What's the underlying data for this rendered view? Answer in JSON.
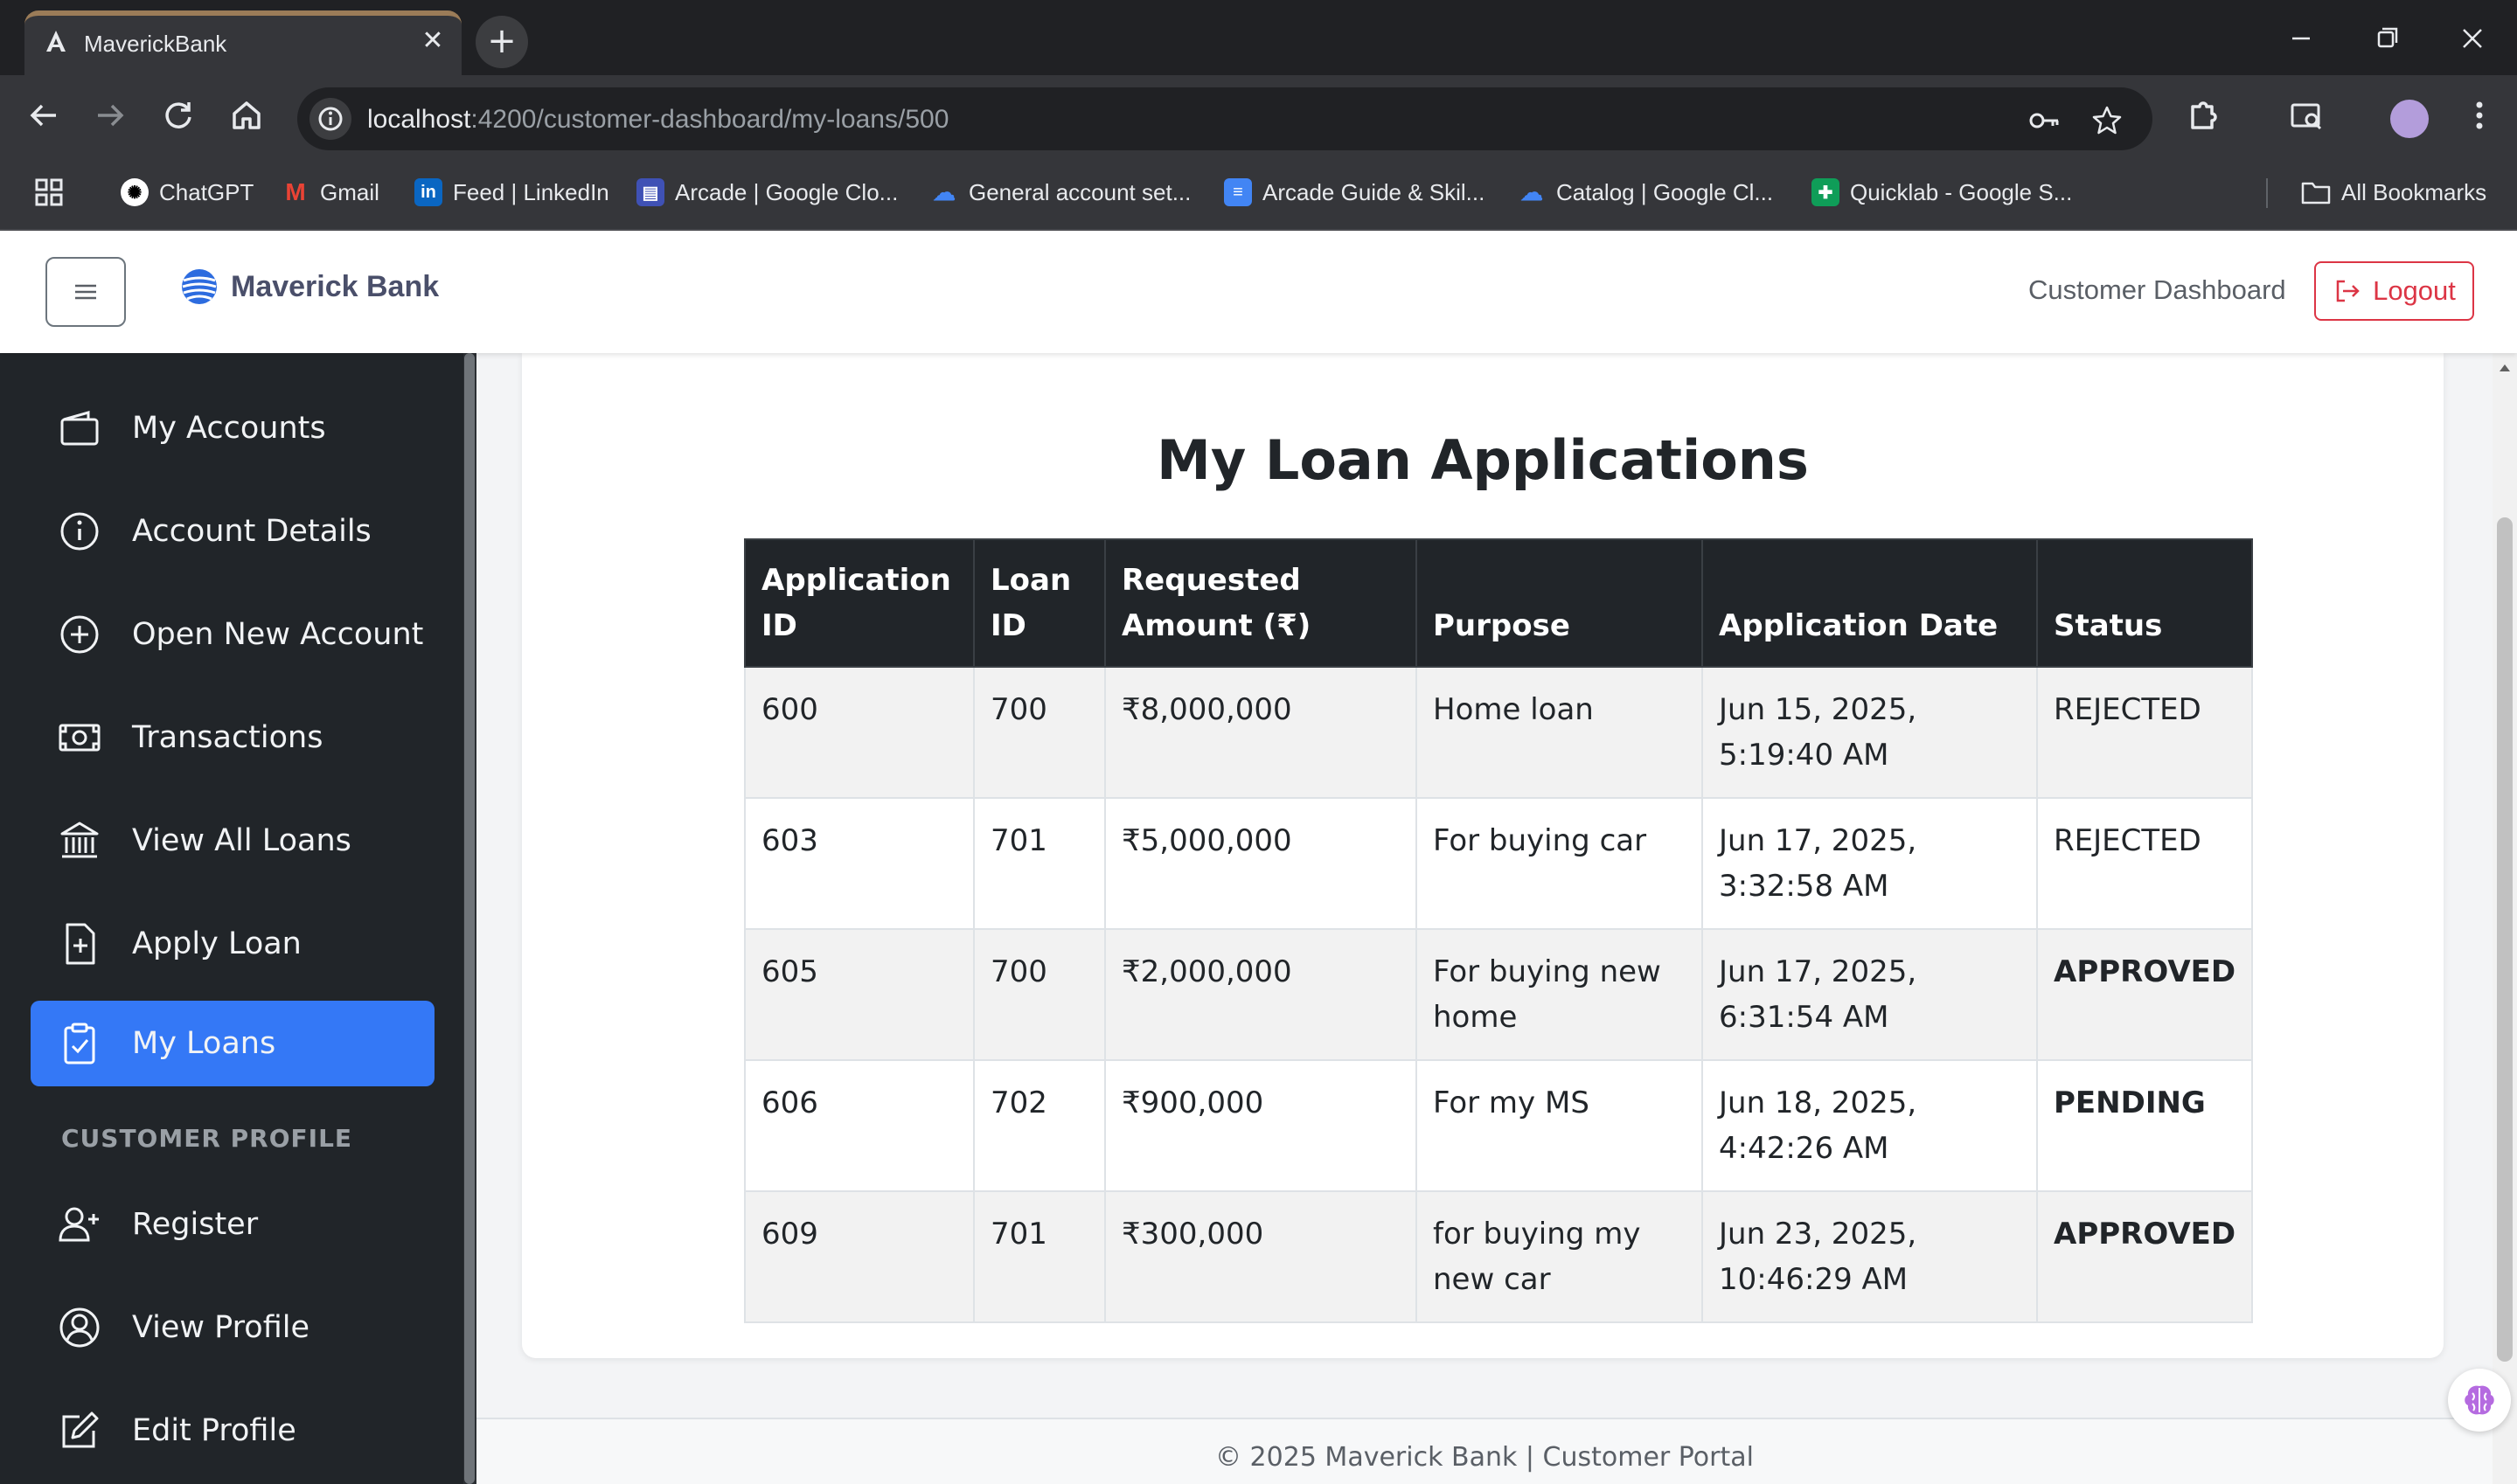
{
  "browser": {
    "tab_title": "MaverickBank",
    "url_host": "localhost",
    "url_path": ":4200/customer-dashboard/my-loans/500",
    "bookmarks": [
      {
        "label": "ChatGPT",
        "icon": "chatgpt-icon"
      },
      {
        "label": "Gmail",
        "icon": "gmail-icon"
      },
      {
        "label": "Feed | LinkedIn",
        "icon": "linkedin-icon"
      },
      {
        "label": "Arcade | Google Clo...",
        "icon": "arcade-icon"
      },
      {
        "label": "General account set...",
        "icon": "google-cloud-icon"
      },
      {
        "label": "Arcade Guide & Skil...",
        "icon": "docs-icon"
      },
      {
        "label": "Catalog | Google Cl...",
        "icon": "google-cloud-icon"
      },
      {
        "label": "Quicklab - Google S...",
        "icon": "sheets-icon"
      }
    ],
    "all_bookmarks": "All Bookmarks"
  },
  "header": {
    "brand": "Maverick Bank",
    "nav_link": "Customer Dashboard",
    "logout": "Logout"
  },
  "sidebar": {
    "items": [
      {
        "label": "My Accounts",
        "icon": "wallet-icon"
      },
      {
        "label": "Account Details",
        "icon": "info-icon"
      },
      {
        "label": "Open New Account",
        "icon": "plus-circle-icon"
      },
      {
        "label": "Transactions",
        "icon": "cash-icon"
      },
      {
        "label": "View All Loans",
        "icon": "bank-icon"
      },
      {
        "label": "Apply Loan",
        "icon": "file-plus-icon"
      },
      {
        "label": "My Loans",
        "icon": "clipboard-check-icon",
        "active": true
      }
    ],
    "profile_heading": "CUSTOMER PROFILE",
    "profile_items": [
      {
        "label": "Register",
        "icon": "person-add-icon"
      },
      {
        "label": "View Profile",
        "icon": "person-circle-icon"
      },
      {
        "label": "Edit Profile",
        "icon": "edit-icon"
      }
    ]
  },
  "main": {
    "title": "My Loan Applications",
    "table": {
      "headers": [
        "Application ID",
        "Loan ID",
        "Requested Amount (₹)",
        "Purpose",
        "Application Date",
        "Status"
      ],
      "rows": [
        {
          "application_id": "600",
          "loan_id": "700",
          "amount": "₹8,000,000",
          "purpose": "Home loan",
          "date": "Jun 15, 2025, 5:19:40 AM",
          "status": "REJECTED"
        },
        {
          "application_id": "603",
          "loan_id": "701",
          "amount": "₹5,000,000",
          "purpose": "For buying car",
          "date": "Jun 17, 2025, 3:32:58 AM",
          "status": "REJECTED"
        },
        {
          "application_id": "605",
          "loan_id": "700",
          "amount": "₹2,000,000",
          "purpose": "For buying new home",
          "date": "Jun 17, 2025, 6:31:54 AM",
          "status": "APPROVED"
        },
        {
          "application_id": "606",
          "loan_id": "702",
          "amount": "₹900,000",
          "purpose": "For my MS",
          "date": "Jun 18, 2025, 4:42:26 AM",
          "status": "PENDING"
        },
        {
          "application_id": "609",
          "loan_id": "701",
          "amount": "₹300,000",
          "purpose": "for buying my new car",
          "date": "Jun 23, 2025, 10:46:29 AM",
          "status": "APPROVED"
        }
      ]
    }
  },
  "footer": {
    "text": "© 2025 Maverick Bank | Customer Portal"
  },
  "colors": {
    "sidebar_bg": "#212529",
    "active_item": "#3478f6",
    "logout": "#dc3545",
    "approved": "#3c9a4c",
    "pending": "#f0b429"
  }
}
